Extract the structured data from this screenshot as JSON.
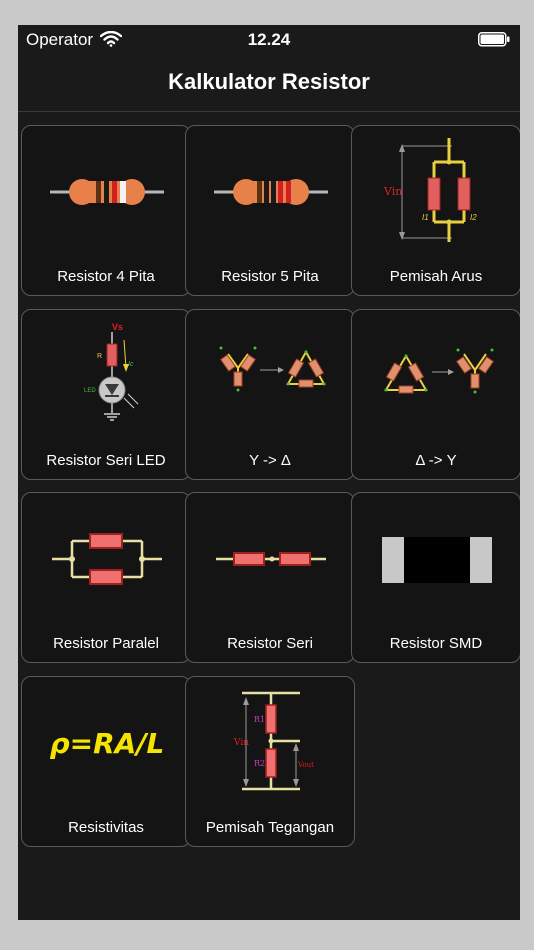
{
  "status_bar": {
    "carrier": "Operator",
    "time": "12.24"
  },
  "nav": {
    "title": "Kalkulator Resistor"
  },
  "colors": {
    "background": "#1a1a1a",
    "tile_bg": "#141414",
    "tile_border": "#5a5a5a",
    "resistor_body": "#e8804a",
    "wire": "#e8e0a0",
    "resistor_red": "#e05050",
    "formula_yellow": "#f5e400"
  },
  "tiles": [
    {
      "label": "Resistor 4 Pita",
      "icon": "resistor-4-band-icon"
    },
    {
      "label": "Resistor 5 Pita",
      "icon": "resistor-5-band-icon"
    },
    {
      "label": "Pemisah Arus",
      "icon": "current-divider-icon"
    },
    {
      "label": "Resistor Seri LED",
      "icon": "led-series-resistor-icon"
    },
    {
      "label": "Y -> Δ",
      "icon": "wye-to-delta-icon"
    },
    {
      "label": "Δ -> Y",
      "icon": "delta-to-wye-icon"
    },
    {
      "label": "Resistor Paralel",
      "icon": "parallel-resistor-icon"
    },
    {
      "label": "Resistor Seri",
      "icon": "series-resistor-icon"
    },
    {
      "label": "Resistor SMD",
      "icon": "smd-resistor-icon"
    },
    {
      "label": "Resistivitas",
      "icon": "resistivity-formula-icon"
    },
    {
      "label": "Pemisah Tegangan",
      "icon": "voltage-divider-icon"
    }
  ],
  "art_text": {
    "vin": "Vin",
    "i1": "I1",
    "i2": "I2",
    "vs": "Vs",
    "r": "R",
    "ic": "Ic",
    "led": "LED",
    "r1": "R1",
    "r2": "R2",
    "vout": "Vout",
    "formula": "ρ=RA/L"
  }
}
